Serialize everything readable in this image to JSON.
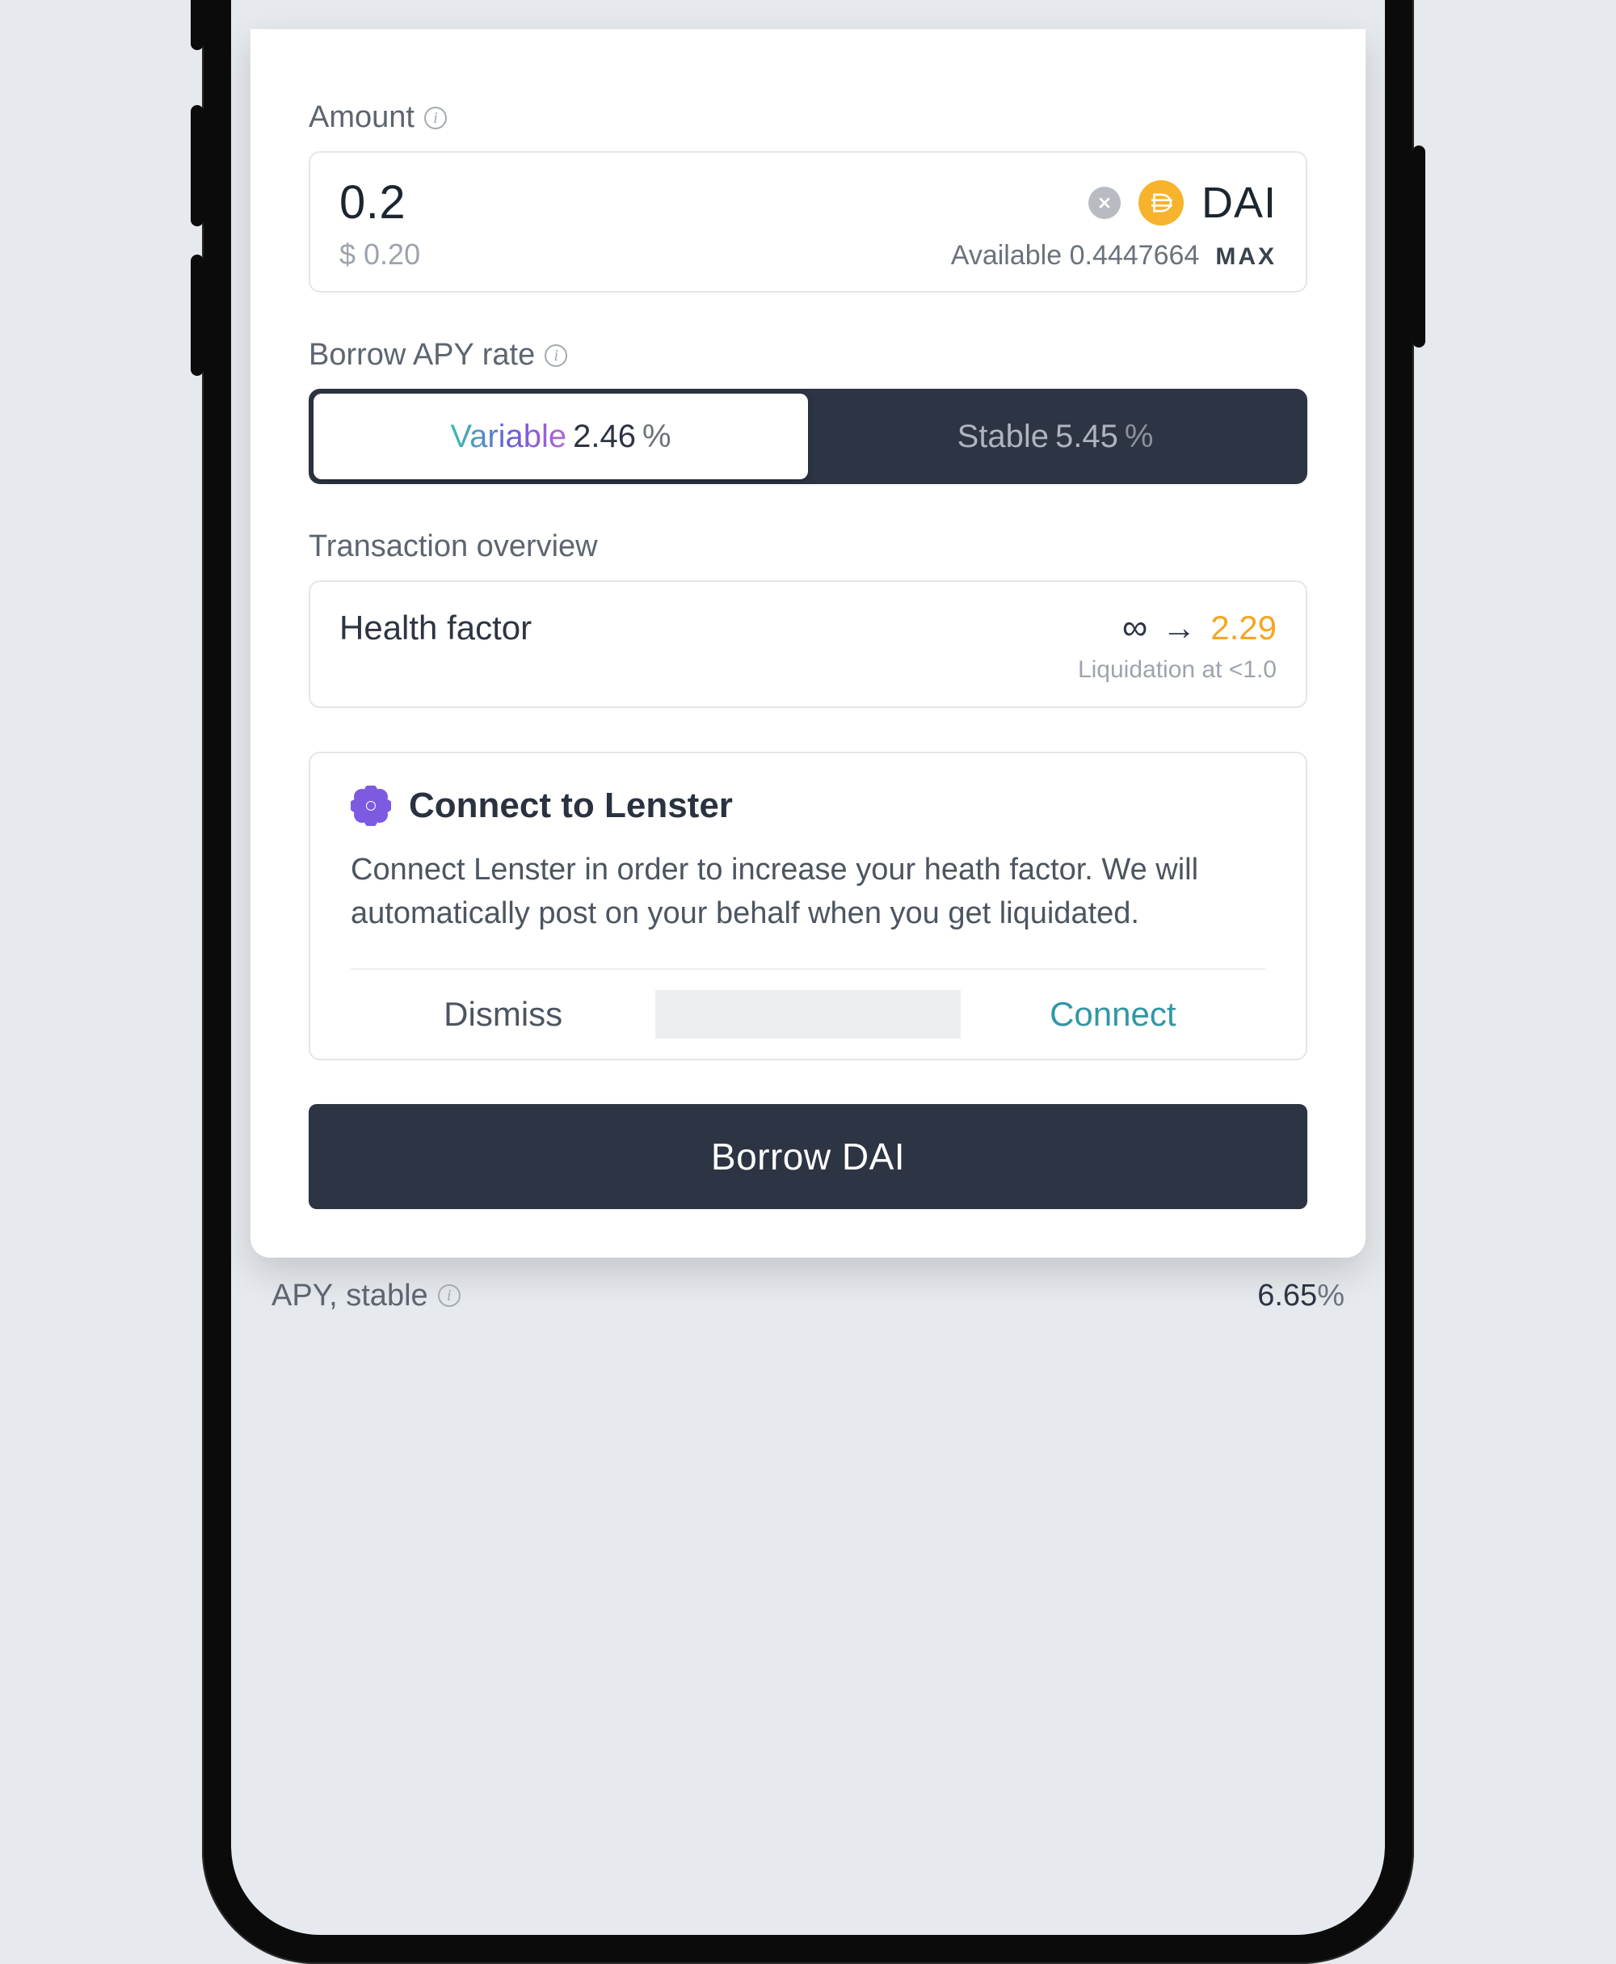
{
  "amount": {
    "label": "Amount",
    "value": "0.2",
    "fiat": "$ 0.20",
    "token_symbol": "DAI",
    "available_label": "Available",
    "available_value": "0.4447664",
    "max_label": "MAX"
  },
  "apy": {
    "label": "Borrow APY rate",
    "variable_label": "Variable",
    "variable_value": "2.46",
    "stable_label": "Stable",
    "stable_value": "5.45",
    "pct": "%"
  },
  "overview": {
    "label": "Transaction overview",
    "hf_label": "Health factor",
    "hf_from": "∞",
    "hf_arrow": "→",
    "hf_to": "2.29",
    "liq_note": "Liquidation at <1.0"
  },
  "lenster": {
    "title": "Connect to Lenster",
    "body": "Connect Lenster in order to increase your heath factor. We will automatically post on your behalf when you get liquidated.",
    "dismiss": "Dismiss",
    "connect": "Connect"
  },
  "primary_action": "Borrow DAI",
  "underlay": {
    "label": "APY, stable",
    "value": "6.65",
    "pct": "%"
  },
  "colors": {
    "accent_orange": "#F5A623",
    "token_yellow": "#F7B32B",
    "lenster_purple": "#7C5BE0",
    "dark": "#2D3443",
    "connect_teal": "#3197A6"
  }
}
